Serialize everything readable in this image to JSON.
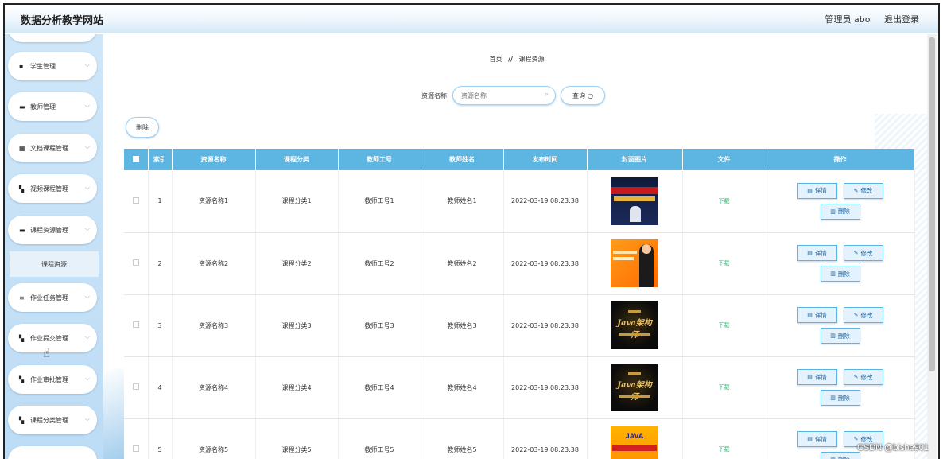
{
  "header": {
    "site_title": "数据分析教学网站",
    "admin_label": "管理员 abo",
    "logout_label": "退出登录"
  },
  "sidebar": {
    "items": [
      {
        "label": "学生管理",
        "icon": "clipboard-icon"
      },
      {
        "label": "教师管理",
        "icon": "briefcase-icon"
      },
      {
        "label": "文档课程管理",
        "icon": "grid-icon"
      },
      {
        "label": "视频课程管理",
        "icon": "apps-icon"
      },
      {
        "label": "课程资源管理",
        "icon": "book-icon"
      },
      {
        "label": "作业任务管理",
        "icon": "list-icon"
      },
      {
        "label": "作业提交管理",
        "icon": "apps-icon"
      },
      {
        "label": "作业审批管理",
        "icon": "apps-icon"
      },
      {
        "label": "课程分类管理",
        "icon": "apps-icon"
      }
    ],
    "active_sub_item": "课程资源"
  },
  "breadcrumb": {
    "home": "首页",
    "separator": "//",
    "current": "课程资源"
  },
  "search": {
    "label": "资源名称",
    "placeholder": "资源名称",
    "query_button": "查询"
  },
  "toolbar": {
    "delete_label": "删除"
  },
  "table": {
    "columns": [
      "索引",
      "资源名称",
      "课程分类",
      "教师工号",
      "教师姓名",
      "发布时间",
      "封面图片",
      "文件",
      "操作"
    ],
    "rows": [
      {
        "index": "1",
        "name": "资源名称1",
        "category": "课程分类1",
        "teacher_id": "教师工号1",
        "teacher_name": "教师姓名1",
        "time": "2022-03-19 08:23:38",
        "file": "下载",
        "cover_style": "dark-blue"
      },
      {
        "index": "2",
        "name": "资源名称2",
        "category": "课程分类2",
        "teacher_id": "教师工号2",
        "teacher_name": "教师姓名2",
        "time": "2022-03-19 08:23:38",
        "file": "下载",
        "cover_style": "orange"
      },
      {
        "index": "3",
        "name": "资源名称3",
        "category": "课程分类3",
        "teacher_id": "教师工号3",
        "teacher_name": "教师姓名3",
        "time": "2022-03-19 08:23:38",
        "file": "下载",
        "cover_style": "gold",
        "cover_text": "Java架构师"
      },
      {
        "index": "4",
        "name": "资源名称4",
        "category": "课程分类4",
        "teacher_id": "教师工号4",
        "teacher_name": "教师姓名4",
        "time": "2022-03-19 08:23:38",
        "file": "下载",
        "cover_style": "gold",
        "cover_text": "Java架构师"
      },
      {
        "index": "5",
        "name": "资源名称5",
        "category": "课程分类5",
        "teacher_id": "教师工号5",
        "teacher_name": "教师姓名5",
        "time": "2022-03-19 08:23:38",
        "file": "下载",
        "cover_style": "gold-orange",
        "cover_text": "JAVA"
      }
    ],
    "actions": {
      "detail": "详情",
      "edit": "修改",
      "delete": "删除"
    }
  },
  "watermark": "CSDN @bishe901",
  "colors": {
    "table_header": "#5db5e2",
    "sidebar_bg": "#cfe6f8",
    "download_link": "#2bb673",
    "op_button_border": "#5ab4e5"
  }
}
